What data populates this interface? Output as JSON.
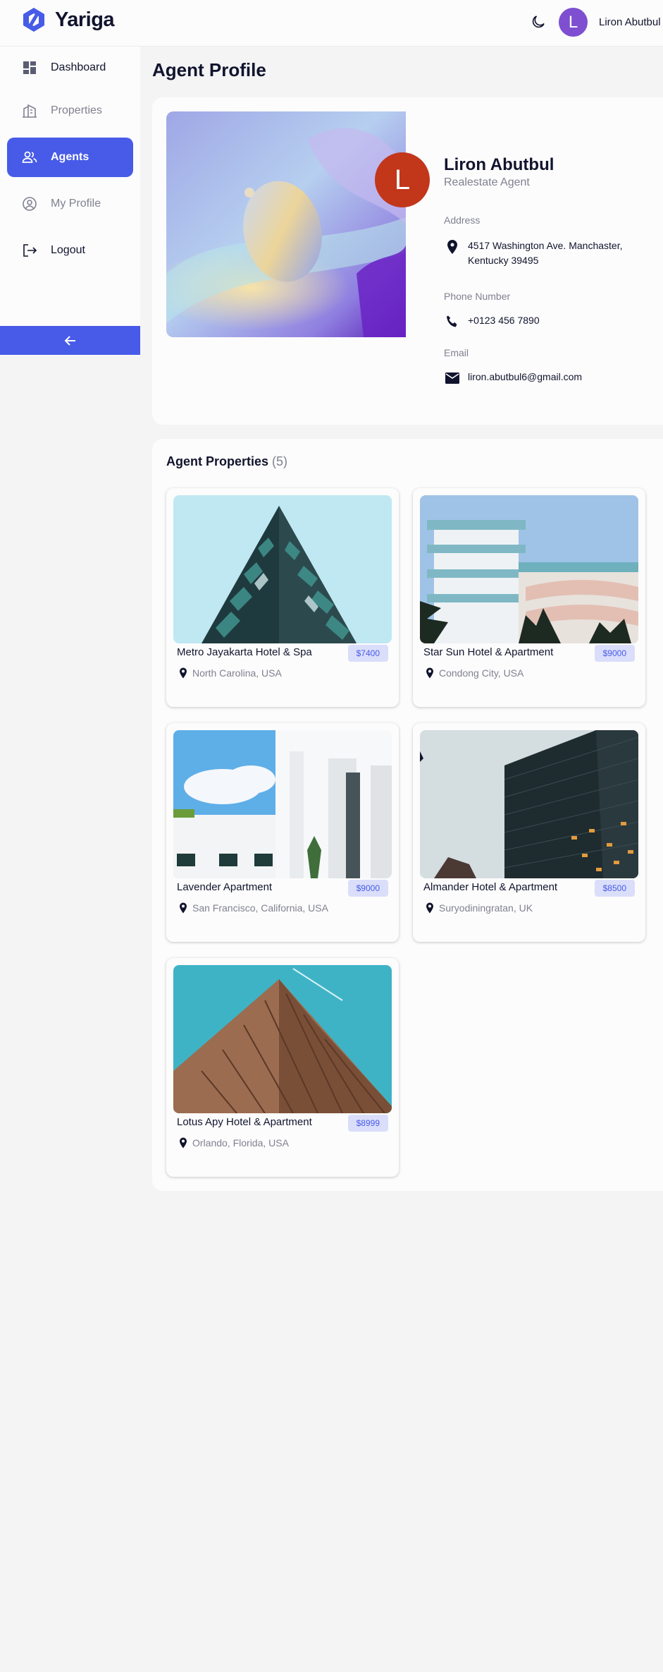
{
  "app": {
    "name": "Yariga"
  },
  "header": {
    "user_initial": "L",
    "user_name": "Liron Abutbul"
  },
  "sidebar": {
    "items": [
      {
        "label": "Dashboard",
        "icon": "dashboard-icon",
        "state": "normal"
      },
      {
        "label": "Properties",
        "icon": "building-icon",
        "state": "dim"
      },
      {
        "label": "Agents",
        "icon": "people-icon",
        "state": "active"
      },
      {
        "label": "My Profile",
        "icon": "account-circle-icon",
        "state": "dim"
      },
      {
        "label": "Logout",
        "icon": "logout-icon",
        "state": "normal"
      }
    ]
  },
  "page": {
    "title": "Agent Profile"
  },
  "profile": {
    "initial": "L",
    "name": "Liron Abutbul",
    "role": "Realestate Agent",
    "address_label": "Address",
    "address_line1": "4517 Washington Ave. Manchaster,",
    "address_line2": "Kentucky 39495",
    "phone_label": "Phone Number",
    "phone": "+0123 456 7890",
    "email_label": "Email",
    "email": "liron.abutbul6@gmail.com"
  },
  "properties": {
    "title": "Agent Properties",
    "count": "(5)",
    "items": [
      {
        "title": "Metro Jayakarta Hotel & Spa",
        "price": "$7400",
        "location": "North Carolina, USA"
      },
      {
        "title": "Star Sun Hotel & Apartment",
        "price": "$9000",
        "location": "Condong City, USA"
      },
      {
        "title": "Lavender Apartment",
        "price": "$9000",
        "location": "San Francisco, California, USA"
      },
      {
        "title": "Almander Hotel & Apartment",
        "price": "$8500",
        "location": "Suryodiningratan, UK"
      },
      {
        "title": "Lotus Apy Hotel & Apartment",
        "price": "$8999",
        "location": "Orlando, Florida, USA"
      }
    ]
  },
  "colors": {
    "accent": "#475be8",
    "accent_light": "#dadefa",
    "text": "#11142d",
    "muted": "#808191",
    "avatar_bg": "#c2361a",
    "header_avatar_bg": "#7e4fd0"
  }
}
